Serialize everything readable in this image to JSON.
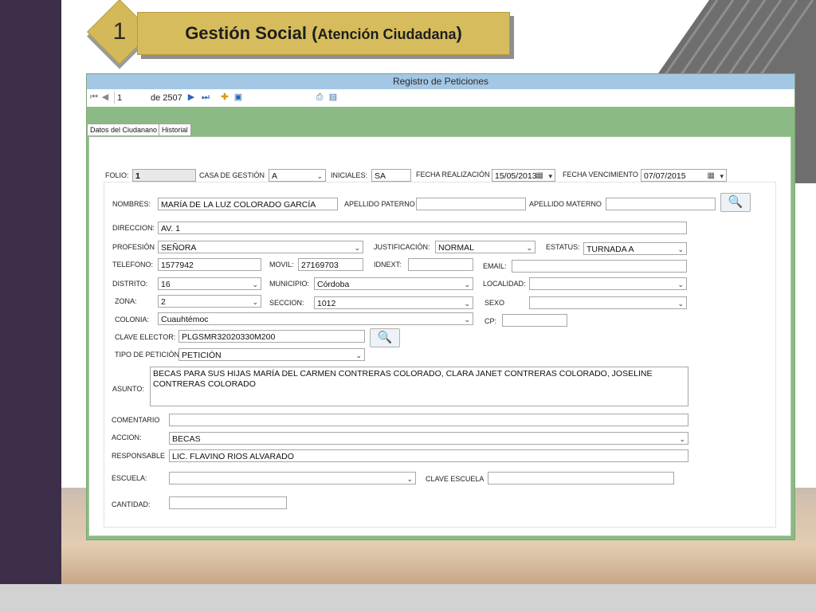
{
  "slide": {
    "number": "1",
    "title_main": "Gestión Social (",
    "title_sub": "Atención Ciudadana",
    "title_close": ")"
  },
  "window": {
    "title": "Registro de Peticiones"
  },
  "toolbar": {
    "record": "1",
    "of_total": "de 2507"
  },
  "tabs": [
    {
      "label": "Datos del Ciudanano"
    },
    {
      "label": "Historial"
    }
  ],
  "form": {
    "folio": {
      "label": "FOLIO:",
      "value": "1"
    },
    "casa": {
      "label": "CASA DE GESTIÓN",
      "value": "A"
    },
    "iniciales": {
      "label": "INICIALES:",
      "value": "SA"
    },
    "fecha_realizacion": {
      "label": "FECHA REALIZACIÓN",
      "value": "15/05/2013"
    },
    "fecha_vencimiento": {
      "label": "FECHA VENCIMIENTO",
      "value": "07/07/2015"
    },
    "nombres": {
      "label": "NOMBRES:",
      "value": "MARÍA DE LA LUZ COLORADO GARCÍA"
    },
    "apellido_paterno": {
      "label": "APELLIDO PATERNO",
      "value": ""
    },
    "apellido_materno": {
      "label": "APELLIDO MATERNO",
      "value": ""
    },
    "direccion": {
      "label": "DIRECCION:",
      "value": "AV. 1"
    },
    "profesion": {
      "label": "PROFESIÒN",
      "value": "SEÑORA"
    },
    "justificacion": {
      "label": "JUSTIFICACIÓN:",
      "value": "NORMAL"
    },
    "estatus": {
      "label": "ESTATUS:",
      "value": "TURNADA A"
    },
    "telefono": {
      "label": "TELEFONO:",
      "value": "1577942"
    },
    "movil": {
      "label": "MOVIL:",
      "value": "27169703"
    },
    "idnext": {
      "label": "IDNEXT:",
      "value": ""
    },
    "email": {
      "label": "EMAIL:",
      "value": ""
    },
    "distrito": {
      "label": "DISTRITO:",
      "value": "16"
    },
    "municipio": {
      "label": "MUNICIPIO:",
      "value": "Córdoba"
    },
    "localidad": {
      "label": "LOCALIDAD:",
      "value": ""
    },
    "zona": {
      "label": "ZONA:",
      "value": "2"
    },
    "seccion": {
      "label": "SECCION:",
      "value": "1012"
    },
    "sexo": {
      "label": "SEXO",
      "value": ""
    },
    "colonia": {
      "label": "COLONIA:",
      "value": "Cuauhtémoc"
    },
    "cp": {
      "label": "CP:",
      "value": ""
    },
    "clave_elector": {
      "label": "CLAVE ELECTOR:",
      "value": "PLGSMR32020330M200"
    },
    "tipo_peticion": {
      "label": "TIPO DE PETICIÓN",
      "value": "PETICIÓN"
    },
    "asunto": {
      "label": "ASUNTO:",
      "value": "BECAS PARA SUS HIJAS MARÍA DEL CARMEN CONTRERAS COLORADO, CLARA JANET CONTRERAS COLORADO, JOSELINE CONTRERAS COLORADO"
    },
    "comentario": {
      "label": "COMENTARIO",
      "value": ""
    },
    "accion": {
      "label": "ACCION:",
      "value": "BECAS"
    },
    "responsable": {
      "label": "RESPONSABLE",
      "value": "LIC. FLAVINO RIOS ALVARADO"
    },
    "escuela": {
      "label": "ESCUELA:",
      "value": ""
    },
    "clave_escuela": {
      "label": "CLAVE ESCUELA",
      "value": ""
    },
    "cantidad": {
      "label": "CANTIDAD:",
      "value": ""
    }
  },
  "icons": [
    "first-record-icon",
    "prev-record-icon",
    "next-record-icon",
    "last-record-icon",
    "add-icon",
    "save-icon",
    "print-preview-icon",
    "print-icon",
    "search-icon",
    "dropdown-icon",
    "calendar-icon"
  ]
}
